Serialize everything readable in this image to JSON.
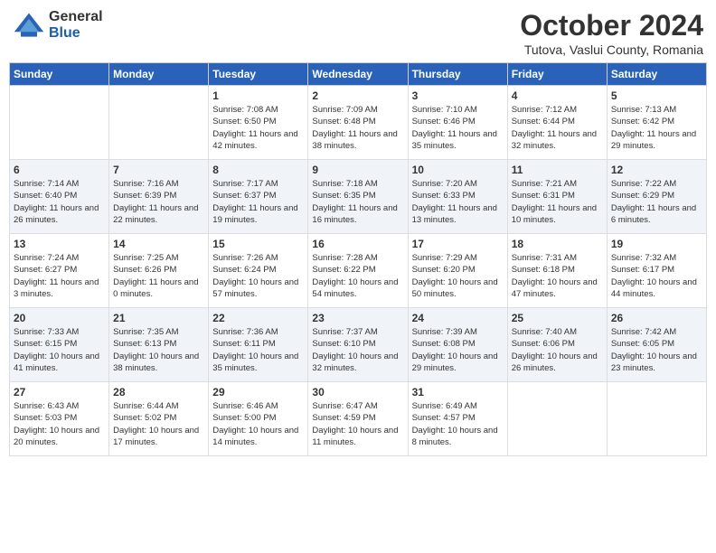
{
  "header": {
    "logo_general": "General",
    "logo_blue": "Blue",
    "month": "October 2024",
    "location": "Tutova, Vaslui County, Romania"
  },
  "days_of_week": [
    "Sunday",
    "Monday",
    "Tuesday",
    "Wednesday",
    "Thursday",
    "Friday",
    "Saturday"
  ],
  "weeks": [
    [
      {
        "day": "",
        "content": ""
      },
      {
        "day": "",
        "content": ""
      },
      {
        "day": "1",
        "content": "Sunrise: 7:08 AM\nSunset: 6:50 PM\nDaylight: 11 hours and 42 minutes."
      },
      {
        "day": "2",
        "content": "Sunrise: 7:09 AM\nSunset: 6:48 PM\nDaylight: 11 hours and 38 minutes."
      },
      {
        "day": "3",
        "content": "Sunrise: 7:10 AM\nSunset: 6:46 PM\nDaylight: 11 hours and 35 minutes."
      },
      {
        "day": "4",
        "content": "Sunrise: 7:12 AM\nSunset: 6:44 PM\nDaylight: 11 hours and 32 minutes."
      },
      {
        "day": "5",
        "content": "Sunrise: 7:13 AM\nSunset: 6:42 PM\nDaylight: 11 hours and 29 minutes."
      }
    ],
    [
      {
        "day": "6",
        "content": "Sunrise: 7:14 AM\nSunset: 6:40 PM\nDaylight: 11 hours and 26 minutes."
      },
      {
        "day": "7",
        "content": "Sunrise: 7:16 AM\nSunset: 6:39 PM\nDaylight: 11 hours and 22 minutes."
      },
      {
        "day": "8",
        "content": "Sunrise: 7:17 AM\nSunset: 6:37 PM\nDaylight: 11 hours and 19 minutes."
      },
      {
        "day": "9",
        "content": "Sunrise: 7:18 AM\nSunset: 6:35 PM\nDaylight: 11 hours and 16 minutes."
      },
      {
        "day": "10",
        "content": "Sunrise: 7:20 AM\nSunset: 6:33 PM\nDaylight: 11 hours and 13 minutes."
      },
      {
        "day": "11",
        "content": "Sunrise: 7:21 AM\nSunset: 6:31 PM\nDaylight: 11 hours and 10 minutes."
      },
      {
        "day": "12",
        "content": "Sunrise: 7:22 AM\nSunset: 6:29 PM\nDaylight: 11 hours and 6 minutes."
      }
    ],
    [
      {
        "day": "13",
        "content": "Sunrise: 7:24 AM\nSunset: 6:27 PM\nDaylight: 11 hours and 3 minutes."
      },
      {
        "day": "14",
        "content": "Sunrise: 7:25 AM\nSunset: 6:26 PM\nDaylight: 11 hours and 0 minutes."
      },
      {
        "day": "15",
        "content": "Sunrise: 7:26 AM\nSunset: 6:24 PM\nDaylight: 10 hours and 57 minutes."
      },
      {
        "day": "16",
        "content": "Sunrise: 7:28 AM\nSunset: 6:22 PM\nDaylight: 10 hours and 54 minutes."
      },
      {
        "day": "17",
        "content": "Sunrise: 7:29 AM\nSunset: 6:20 PM\nDaylight: 10 hours and 50 minutes."
      },
      {
        "day": "18",
        "content": "Sunrise: 7:31 AM\nSunset: 6:18 PM\nDaylight: 10 hours and 47 minutes."
      },
      {
        "day": "19",
        "content": "Sunrise: 7:32 AM\nSunset: 6:17 PM\nDaylight: 10 hours and 44 minutes."
      }
    ],
    [
      {
        "day": "20",
        "content": "Sunrise: 7:33 AM\nSunset: 6:15 PM\nDaylight: 10 hours and 41 minutes."
      },
      {
        "day": "21",
        "content": "Sunrise: 7:35 AM\nSunset: 6:13 PM\nDaylight: 10 hours and 38 minutes."
      },
      {
        "day": "22",
        "content": "Sunrise: 7:36 AM\nSunset: 6:11 PM\nDaylight: 10 hours and 35 minutes."
      },
      {
        "day": "23",
        "content": "Sunrise: 7:37 AM\nSunset: 6:10 PM\nDaylight: 10 hours and 32 minutes."
      },
      {
        "day": "24",
        "content": "Sunrise: 7:39 AM\nSunset: 6:08 PM\nDaylight: 10 hours and 29 minutes."
      },
      {
        "day": "25",
        "content": "Sunrise: 7:40 AM\nSunset: 6:06 PM\nDaylight: 10 hours and 26 minutes."
      },
      {
        "day": "26",
        "content": "Sunrise: 7:42 AM\nSunset: 6:05 PM\nDaylight: 10 hours and 23 minutes."
      }
    ],
    [
      {
        "day": "27",
        "content": "Sunrise: 6:43 AM\nSunset: 5:03 PM\nDaylight: 10 hours and 20 minutes."
      },
      {
        "day": "28",
        "content": "Sunrise: 6:44 AM\nSunset: 5:02 PM\nDaylight: 10 hours and 17 minutes."
      },
      {
        "day": "29",
        "content": "Sunrise: 6:46 AM\nSunset: 5:00 PM\nDaylight: 10 hours and 14 minutes."
      },
      {
        "day": "30",
        "content": "Sunrise: 6:47 AM\nSunset: 4:59 PM\nDaylight: 10 hours and 11 minutes."
      },
      {
        "day": "31",
        "content": "Sunrise: 6:49 AM\nSunset: 4:57 PM\nDaylight: 10 hours and 8 minutes."
      },
      {
        "day": "",
        "content": ""
      },
      {
        "day": "",
        "content": ""
      }
    ]
  ]
}
